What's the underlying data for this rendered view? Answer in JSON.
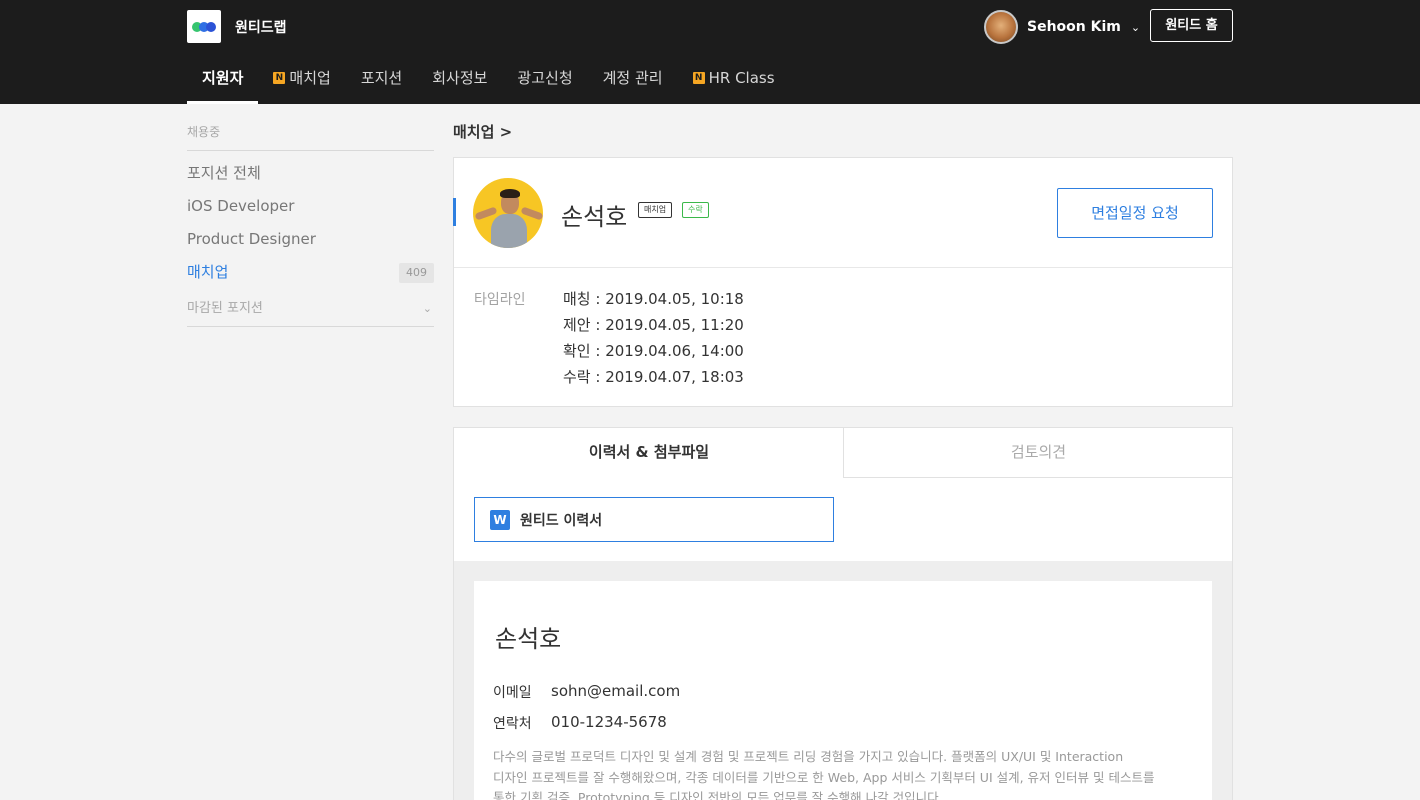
{
  "app": {
    "brand": "원티드랩",
    "user_name": "Sehoon Kim",
    "home_button": "원티드 홈"
  },
  "nav": {
    "items": [
      {
        "label": "지원자",
        "badge": ""
      },
      {
        "label": "매치업",
        "badge": "N"
      },
      {
        "label": "포지션",
        "badge": ""
      },
      {
        "label": "회사정보",
        "badge": ""
      },
      {
        "label": "광고신청",
        "badge": ""
      },
      {
        "label": "계정 관리",
        "badge": ""
      },
      {
        "label": "HR Class",
        "badge": "N"
      }
    ]
  },
  "sidebar": {
    "section_title": "채용중",
    "items": [
      {
        "label": "포지션 전체"
      },
      {
        "label": "iOS Developer"
      },
      {
        "label": "Product Designer"
      },
      {
        "label": "매치업",
        "count": "409"
      }
    ],
    "closed_label": "마감된 포지션"
  },
  "breadcrumb": "매치업 >",
  "candidate": {
    "name": "손석호",
    "tags": [
      "매치업",
      "수락"
    ],
    "interview_button": "면접일정 요청",
    "timeline_label": "타임라인",
    "timeline": [
      "매칭 : 2019.04.05, 10:18",
      "제안 : 2019.04.05, 11:20",
      "확인 : 2019.04.06, 14:00",
      "수락 : 2019.04.07, 18:03"
    ]
  },
  "tabs": {
    "resume": "이력서 & 첨부파일",
    "review": "검토의견"
  },
  "attachment": {
    "icon_letter": "W",
    "file_name": "원티드 이력서"
  },
  "resume": {
    "name": "손석호",
    "email_label": "이메일",
    "email": "sohn@email.com",
    "phone_label": "연락처",
    "phone": "010-1234-5678",
    "summary_lines": [
      "다수의 글로벌 프로덕트 디자인 및 설계 경험 및 프로젝트 리딩 경험을 가지고 있습니다. 플랫폼의 UX/UI 및 Interaction",
      "디자인 프로젝트를 잘 수행해왔으며, 각종 데이터를 기반으로 한 Web, App 서비스 기획부터 UI 설계, 유저 인터뷰 및 테스트를",
      "통한 기획 검증, Prototyping 등 디자인 전반의 모든 업무를 잘 수행해 나갈 것입니다."
    ]
  },
  "colors": {
    "topbar": "#1c1c1c",
    "accent_blue": "#2e7fe0",
    "badge_orange": "#f5a623",
    "accept_green": "#3bb84a"
  }
}
